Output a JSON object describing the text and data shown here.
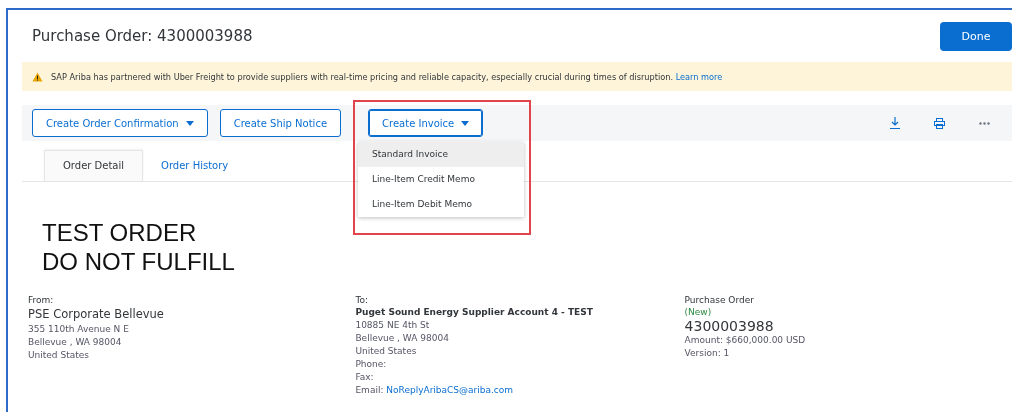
{
  "title": "Purchase Order: 4300003988",
  "done_button": "Done",
  "banner": {
    "text": "SAP Ariba has partnered with Uber Freight to provide suppliers with real-time pricing and reliable capacity, especially crucial during times of disruption.",
    "link": "Learn more"
  },
  "toolbar": {
    "buttons": [
      {
        "label": "Create Order Confirmation",
        "caret": true,
        "expanded": false
      },
      {
        "label": "Create Ship Notice",
        "caret": false,
        "expanded": false
      },
      {
        "label": "Create Invoice",
        "caret": true,
        "expanded": true
      }
    ],
    "menu": [
      {
        "label": "Standard Invoice",
        "selected": true
      },
      {
        "label": "Line-Item Credit Memo",
        "selected": false
      },
      {
        "label": "Line-Item Debit Memo",
        "selected": false
      }
    ]
  },
  "tabs": [
    {
      "label": "Order Detail",
      "selected": true
    },
    {
      "label": "Order History",
      "selected": false
    }
  ],
  "notice": [
    "TEST ORDER",
    "DO NOT FULFILL"
  ],
  "from": {
    "heading": "From:",
    "name": "PSE Corporate Bellevue",
    "lines": [
      "355 110th Avenue N E",
      "Bellevue , WA 98004",
      "United States"
    ]
  },
  "to": {
    "heading": "To:",
    "name": "Puget Sound Energy Supplier Account 4 - TEST",
    "lines": [
      "10885 NE 4th St",
      "Bellevue , WA 98004",
      "United States",
      "Phone:",
      "Fax:"
    ],
    "email_label": "Email:",
    "email": "NoReplyAribaCS@ariba.com"
  },
  "order": {
    "heading": "Purchase Order",
    "status": "(New)",
    "number": "4300003988",
    "amount": "Amount: $660,000.00 USD",
    "version": "Version: 1"
  }
}
